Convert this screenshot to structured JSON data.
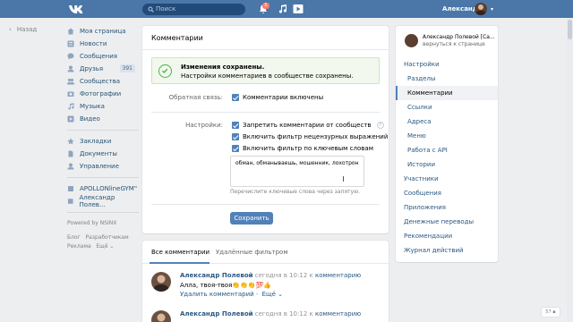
{
  "topbar": {
    "search_placeholder": "Поиск",
    "notif_count": "5",
    "user_name": "Александр",
    "brand_color": "#4a76a8"
  },
  "back_label": "Назад",
  "left_nav": {
    "items": [
      {
        "label": "Моя страница",
        "icon": "home-icon"
      },
      {
        "label": "Новости",
        "icon": "news-icon"
      },
      {
        "label": "Сообщения",
        "icon": "message-icon"
      },
      {
        "label": "Друзья",
        "icon": "friends-icon",
        "count": "391"
      },
      {
        "label": "Сообщества",
        "icon": "groups-icon"
      },
      {
        "label": "Фотографии",
        "icon": "photo-icon"
      },
      {
        "label": "Музыка",
        "icon": "music-icon"
      },
      {
        "label": "Видео",
        "icon": "video-icon"
      }
    ],
    "items2": [
      {
        "label": "Закладки",
        "icon": "star-icon"
      },
      {
        "label": "Документы",
        "icon": "document-icon"
      },
      {
        "label": "Управление",
        "icon": "manage-icon"
      }
    ],
    "items3": [
      {
        "label": "APOLLONlineGYM\""
      },
      {
        "label": "Александр Полев..."
      }
    ],
    "powered": "Powered by NSINX",
    "footer": [
      "Блог",
      "Разработчикам",
      "Реклама",
      "Ещё ⌄"
    ]
  },
  "main": {
    "title": "Комментарии",
    "success_title": "Изменения сохранены.",
    "success_text": "Настройки комментариев в сообществе сохранены.",
    "feedback_label": "Обратная связь:",
    "feedback_option": "Комментарии включены",
    "settings_label": "Настройки:",
    "options": [
      "Запретить комментарии от сообществ",
      "Включить фильтр нецензурных выражений",
      "Включить фильтр по ключевым словам"
    ],
    "help": "?",
    "keywords": "обман, обманываешь, мошенник, лохотрон",
    "hint": "Перечислите ключевые слова через запятую.",
    "save": "Сохранить"
  },
  "comments": {
    "tabs": [
      "Все комментарии",
      "Удалённые фильтром"
    ],
    "items": [
      {
        "author": "Александр Полевой",
        "when": "сегодня в 10:12 к",
        "link": "комментарию",
        "text": "Алла, твоя-твоя👏👏👏💯👍",
        "reply": "Удалить комментарий",
        "more": "Ещё ⌄"
      },
      {
        "author": "Александр Полевой",
        "when": "сегодня в 10:12 к",
        "link": "комментарию",
        "text": "",
        "reply": "",
        "more": ""
      }
    ]
  },
  "right_nav": {
    "group_name": "Александр Полевой [Са...",
    "group_back": "вернуться к странице",
    "items": [
      {
        "label": "Настройки",
        "sub": false
      },
      {
        "label": "Разделы",
        "sub": true
      },
      {
        "label": "Комментарии",
        "sub": true,
        "selected": true
      },
      {
        "label": "Ссылки",
        "sub": true
      },
      {
        "label": "Адреса",
        "sub": true
      },
      {
        "label": "Меню",
        "sub": true
      },
      {
        "label": "Работа с API",
        "sub": true
      },
      {
        "label": "Истории",
        "sub": true
      },
      {
        "label": "Участники",
        "sub": false
      },
      {
        "label": "Сообщения",
        "sub": false
      },
      {
        "label": "Приложения",
        "sub": false
      },
      {
        "label": "Денежные переводы",
        "sub": false
      },
      {
        "label": "Рекомендации",
        "sub": false
      },
      {
        "label": "Журнал действий",
        "sub": false
      }
    ]
  },
  "chat_count": "57"
}
